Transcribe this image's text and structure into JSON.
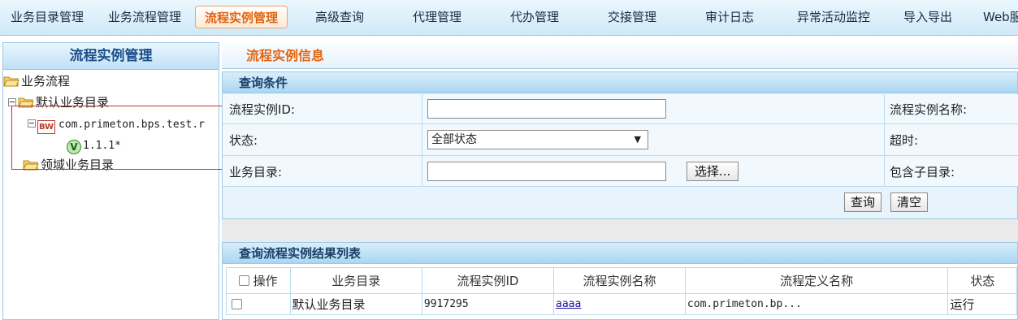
{
  "nav": {
    "items": [
      "业务目录管理",
      "业务流程管理",
      "流程实例管理",
      "高级查询",
      "代理管理",
      "代办管理",
      "交接管理",
      "审计日志",
      "异常活动监控",
      "导入导出",
      "Web服"
    ],
    "active_index": 2
  },
  "left": {
    "title": "流程实例管理",
    "tree": {
      "root": "业务流程",
      "default_dir": "默认业务目录",
      "process": "com.primeton.bps.test.r",
      "process_icon": "BW",
      "version_icon": "V",
      "version": "1.1.1*",
      "domain_dir": "领域业务目录"
    }
  },
  "main": {
    "title": "流程实例信息",
    "query": {
      "section_title": "查询条件",
      "instance_id_label": "流程实例ID:",
      "instance_id_value": "",
      "instance_name_label": "流程实例名称:",
      "status_label": "状态:",
      "status_value": "全部状态",
      "timeout_label": "超时:",
      "catalog_label": "业务目录:",
      "catalog_value": "",
      "select_button": "选择...",
      "include_sub_label": "包含子目录:",
      "query_button": "查询",
      "clear_button": "清空"
    },
    "results": {
      "section_title": "查询流程实例结果列表",
      "columns": [
        "操作",
        "业务目录",
        "流程实例ID",
        "流程实例名称",
        "流程定义名称",
        "状态"
      ],
      "rows": [
        {
          "catalog": "默认业务目录",
          "id": "9917295",
          "name": "aaaa",
          "definition": "com.primeton.bp...",
          "status": "运行"
        }
      ]
    }
  }
}
